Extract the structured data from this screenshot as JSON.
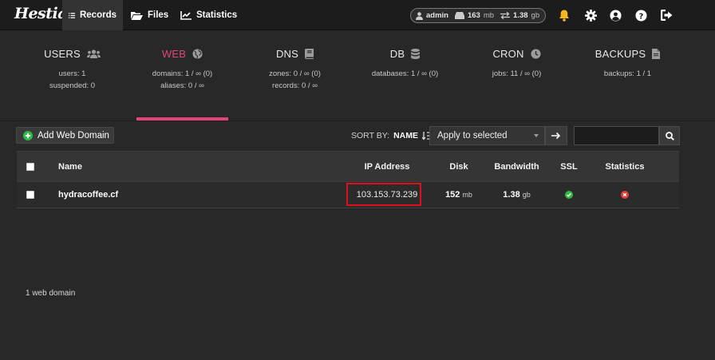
{
  "app": {
    "logo": "Hestia"
  },
  "nav": {
    "records": "Records",
    "files": "Files",
    "statistics": "Statistics"
  },
  "user_pill": {
    "user": "admin",
    "disk_value": "163",
    "disk_unit": "mb",
    "bandwidth_value": "1.38",
    "bandwidth_unit": "gb"
  },
  "tabs": [
    {
      "title": "USERS",
      "icon": "users-icon",
      "lines": [
        "users: 1",
        "suspended: 0"
      ]
    },
    {
      "title": "WEB",
      "icon": "globe-icon",
      "lines": [
        "domains: 1 / ∞ (0)",
        "aliases: 0 / ∞"
      ]
    },
    {
      "title": "DNS",
      "icon": "book-icon",
      "lines": [
        "zones: 0 / ∞ (0)",
        "records: 0 / ∞"
      ]
    },
    {
      "title": "DB",
      "icon": "database-icon",
      "lines": [
        "databases: 1 / ∞ (0)"
      ]
    },
    {
      "title": "CRON",
      "icon": "clock-icon",
      "lines": [
        "jobs: 11 / ∞ (0)"
      ]
    },
    {
      "title": "BACKUPS",
      "icon": "file-icon",
      "lines": [
        "backups: 1 / 1"
      ]
    }
  ],
  "toolbar": {
    "add_label": "Add Web Domain",
    "sort_by_label": "SORT BY:",
    "sort_value": "NAME",
    "bulk_action": "Apply to selected",
    "search_placeholder": ""
  },
  "table": {
    "headers": {
      "name": "Name",
      "ip": "IP Address",
      "disk": "Disk",
      "bandwidth": "Bandwidth",
      "ssl": "SSL",
      "statistics": "Statistics"
    },
    "rows": [
      {
        "name": "hydracoffee.cf",
        "ip": "103.153.73.239",
        "disk_value": "152",
        "disk_unit": "mb",
        "bandwidth_value": "1.38",
        "bandwidth_unit": "gb",
        "ssl": "enabled",
        "statistics": "disabled"
      }
    ]
  },
  "footer": {
    "count_text": "1 web domain"
  },
  "colors": {
    "accent": "#e2457a",
    "success": "#2fba45",
    "danger": "#e63b3b",
    "highlight_box": "#e0101b"
  }
}
